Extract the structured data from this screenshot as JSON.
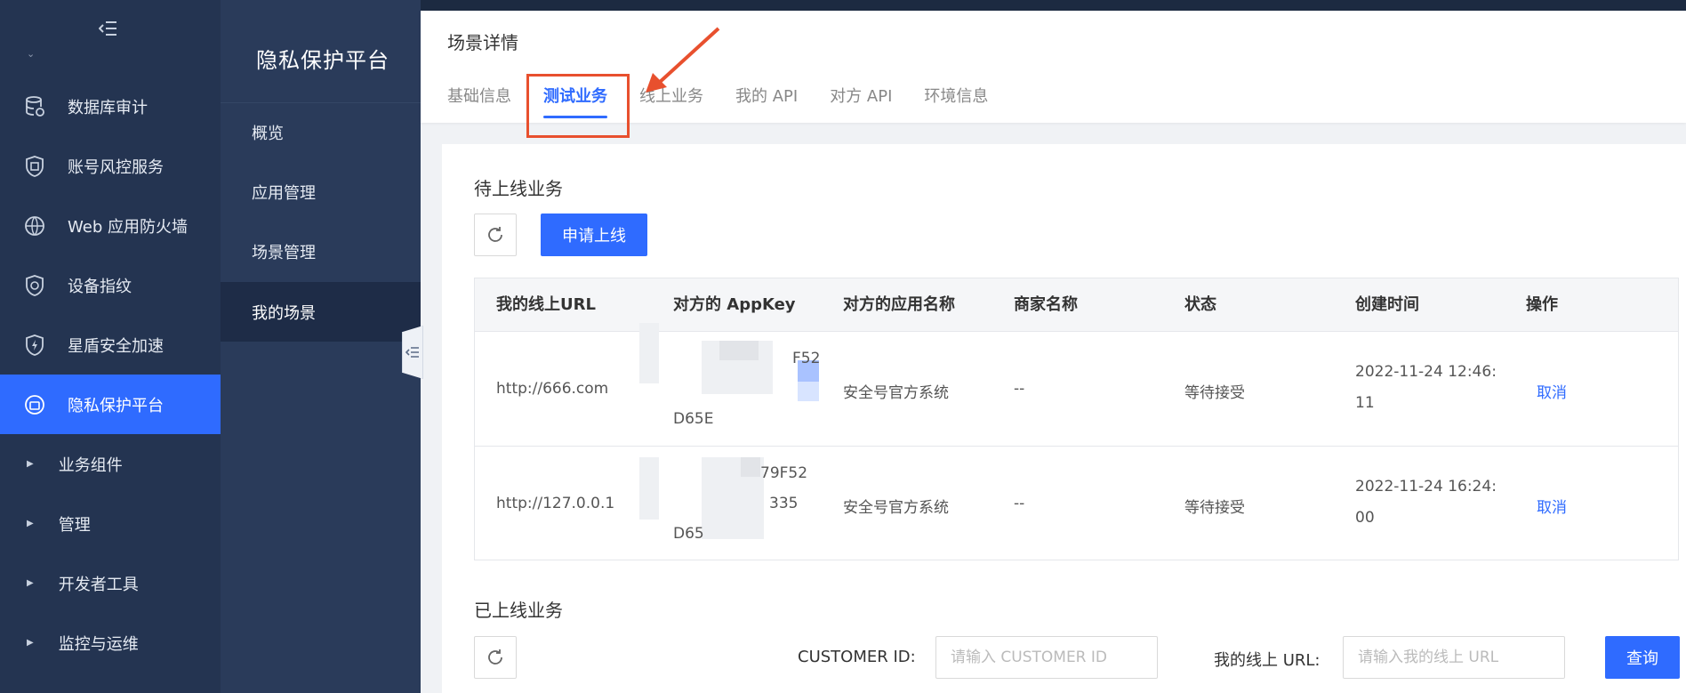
{
  "leftnav": {
    "items": [
      {
        "label": "数据库审计",
        "icon": "database-icon"
      },
      {
        "label": "账号风控服务",
        "icon": "shield-account-icon"
      },
      {
        "label": "Web 应用防火墙",
        "icon": "firewall-icon"
      },
      {
        "label": "设备指纹",
        "icon": "fingerprint-icon"
      },
      {
        "label": "星盾安全加速",
        "icon": "lightning-shield-icon"
      },
      {
        "label": "隐私保护平台",
        "icon": "privacy-icon",
        "active": true
      }
    ],
    "groups": [
      {
        "label": "业务组件"
      },
      {
        "label": "管理"
      },
      {
        "label": "开发者工具"
      },
      {
        "label": "监控与运维"
      }
    ]
  },
  "subnav": {
    "title": "隐私保护平台",
    "items": [
      {
        "label": "概览"
      },
      {
        "label": "应用管理"
      },
      {
        "label": "场景管理"
      },
      {
        "label": "我的场景",
        "active": true
      }
    ]
  },
  "header": {
    "title": "场景详情",
    "tabs": [
      {
        "label": "基础信息"
      },
      {
        "label": "测试业务",
        "active": true
      },
      {
        "label": "线上业务"
      },
      {
        "label": "我的 API"
      },
      {
        "label": "对方 API"
      },
      {
        "label": "环境信息"
      }
    ]
  },
  "pending": {
    "title": "待上线业务",
    "apply_label": "申请上线",
    "columns": [
      "我的线上URL",
      "对方的 AppKey",
      "对方的应用名称",
      "商家名称",
      "状态",
      "创建时间",
      "操作"
    ],
    "rows": [
      {
        "url": "http://666.com",
        "appkey_l1": "F52",
        "appkey_l2": "D65E",
        "app_name": "安全号官方系统",
        "merchant": "--",
        "status": "等待接受",
        "created_l1": "2022-11-24 12:46:",
        "created_l2": "11",
        "action": "取消"
      },
      {
        "url": "http://127.0.0.1",
        "appkey_l1": "79F52",
        "appkey_l2": "335",
        "appkey_l3": "D65",
        "app_name": "安全号官方系统",
        "merchant": "--",
        "status": "等待接受",
        "created_l1": "2022-11-24 16:24:",
        "created_l2": "00",
        "action": "取消"
      }
    ]
  },
  "online": {
    "title": "已上线业务",
    "customer_label": "CUSTOMER ID:",
    "customer_placeholder": "请输入 CUSTOMER ID",
    "url_label": "我的线上 URL:",
    "url_placeholder": "请输入我的线上 URL",
    "query_label": "查询"
  },
  "colors": {
    "accent": "#2f6bff",
    "nav_bg": "#243451",
    "subnav_bg": "#2a3b5a",
    "highlight": "#e8502e"
  }
}
